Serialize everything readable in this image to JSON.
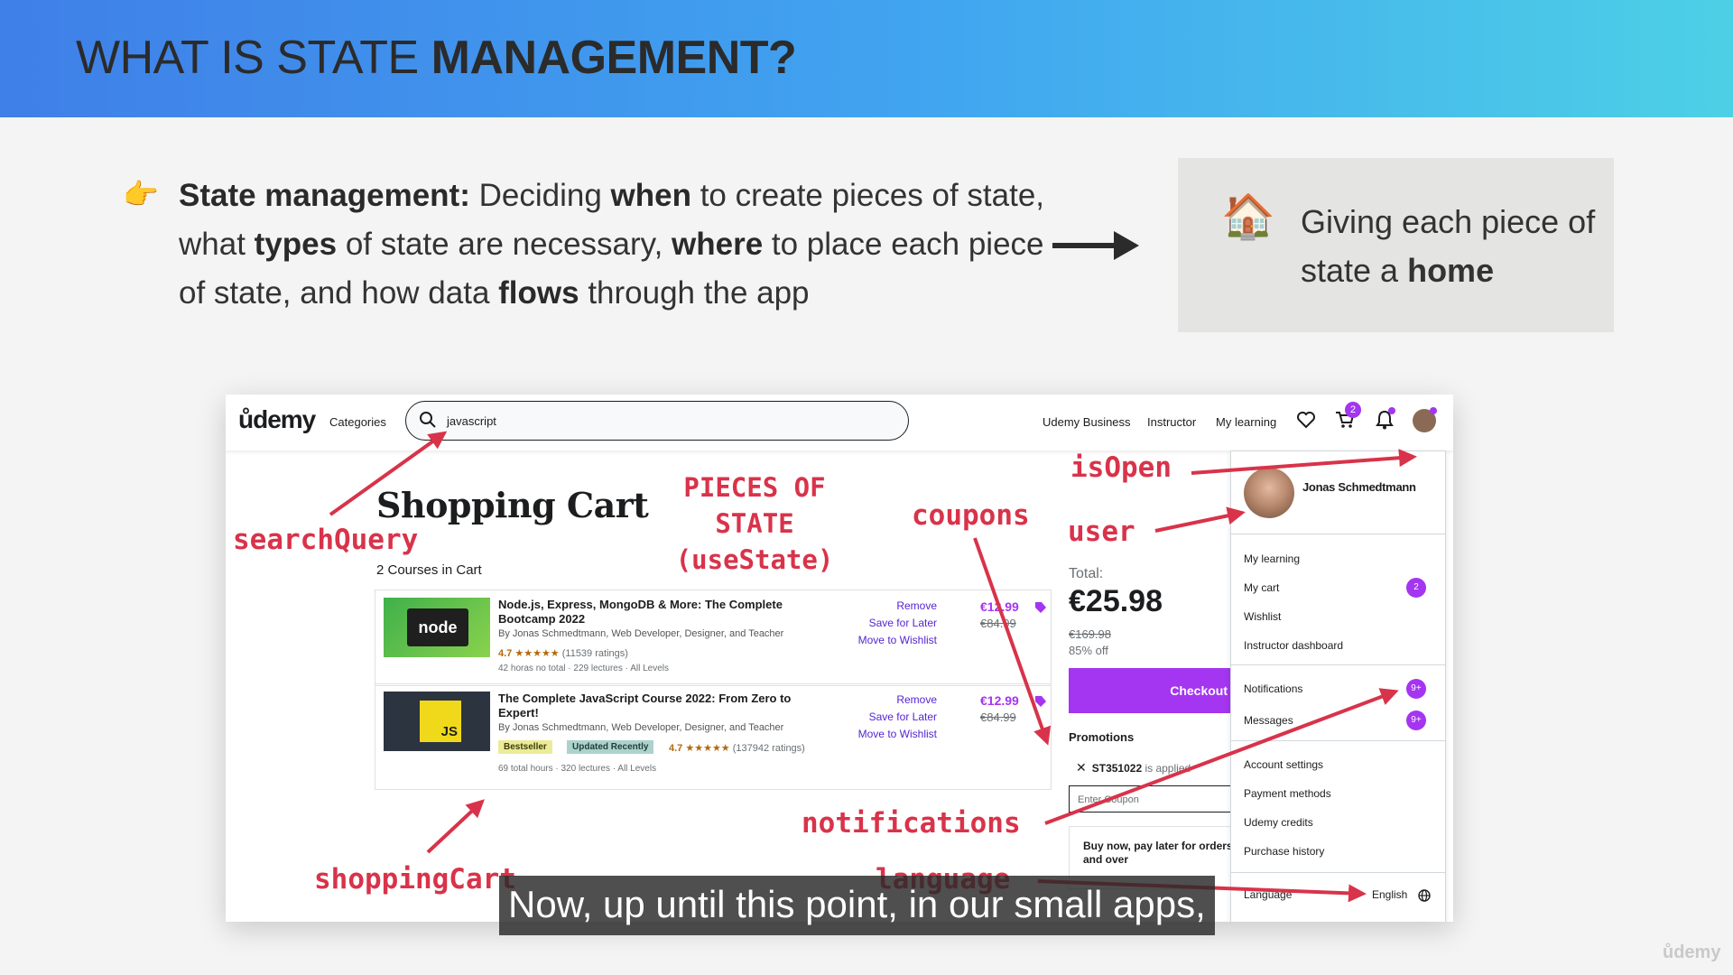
{
  "slide": {
    "title_pre": "WHAT IS STATE ",
    "title_bold": "MANAGEMENT?",
    "bullet_icon": "pointing-hand-emoji",
    "definition": {
      "t1": "State management:",
      "t2": " Deciding ",
      "t3": "when",
      "t4": " to create pieces of state, what ",
      "t5": "types",
      "t6": " of state are necessary, ",
      "t7": "where",
      "t8": " to place each piece of state, and how data ",
      "t9": "flows",
      "t10": " through the app"
    },
    "home_box": {
      "icon": "house-emoji",
      "t1": "Giving each piece of state a ",
      "t2": "home"
    }
  },
  "udemy": {
    "logo": "ůdemy",
    "categories": "Categories",
    "search_value": "javascript",
    "nav": {
      "business": "Udemy Business",
      "instructor": "Instructor",
      "my_learning": "My learning",
      "cart_badge": "2"
    },
    "cart": {
      "title": "Shopping Cart",
      "count": "2 Courses in Cart",
      "courses": [
        {
          "title": "Node.js, Express, MongoDB & More: The Complete Bootcamp 2022",
          "by": "By Jonas Schmedtmann, Web Developer, Designer, and Teacher",
          "rating": "4.7",
          "stars": "★★★★★",
          "ratings": "(11539 ratings)",
          "meta": "42 horas no total · 229 lectures · All Levels",
          "remove": "Remove",
          "save": "Save for Later",
          "wishlist": "Move to Wishlist",
          "price": "€12.99",
          "old_price": "€84.99",
          "thumb_text": "node"
        },
        {
          "title": "The Complete JavaScript Course 2022: From Zero to Expert!",
          "by": "By Jonas Schmedtmann, Web Developer, Designer, and Teacher",
          "tag1": "Bestseller",
          "tag2": "Updated Recently",
          "rating": "4.7",
          "stars": "★★★★★",
          "ratings": "(137942 ratings)",
          "meta": "69 total hours · 320 lectures · All Levels",
          "remove": "Remove",
          "save": "Save for Later",
          "wishlist": "Move to Wishlist",
          "price": "€12.99",
          "old_price": "€84.99",
          "thumb_text": "JS"
        }
      ]
    },
    "summary": {
      "total_label": "Total:",
      "total": "€25.98",
      "original": "€169.98",
      "discount": "85% off",
      "checkout": "Checkout",
      "promotions": "Promotions",
      "coupon_code": "ST351022",
      "coupon_status": " is applied",
      "coupon_placeholder": "Enter Coupon",
      "bnpl": "Buy now, pay later for orders and over"
    },
    "dropdown": {
      "name": "Jonas Schmedtmann",
      "my_learning": "My learning",
      "my_cart": "My cart",
      "my_cart_badge": "2",
      "wishlist": "Wishlist",
      "instructor_dashboard": "Instructor dashboard",
      "notifications": "Notifications",
      "notifications_badge": "9+",
      "messages": "Messages",
      "messages_badge": "9+",
      "account_settings": "Account settings",
      "payment_methods": "Payment methods",
      "udemy_credits": "Udemy credits",
      "purchase_history": "Purchase history",
      "language": "Language",
      "language_value": "English"
    }
  },
  "annotations": {
    "pieces_l1": "PIECES OF",
    "pieces_l2": "STATE",
    "pieces_l3": "(useState)",
    "searchQuery": "searchQuery",
    "shoppingCart": "shoppingCart",
    "coupons": "coupons",
    "isOpen": "isOpen",
    "user": "user",
    "notifications": "notifications",
    "language": "language",
    "color": "#d8334a"
  },
  "caption": "Now, up until this point, in our small apps,",
  "watermark": "ůdemy"
}
